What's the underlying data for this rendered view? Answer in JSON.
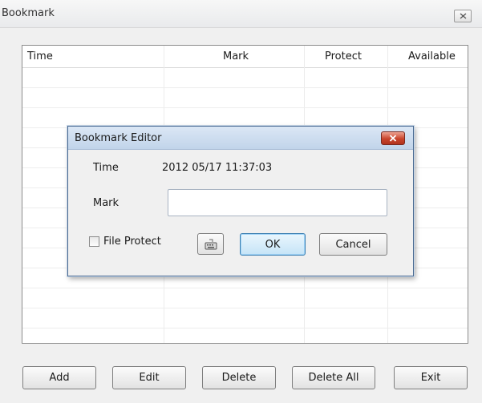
{
  "window": {
    "title": "Bookmark",
    "close_icon": "close-x-icon"
  },
  "list": {
    "columns": [
      "Time",
      "Mark",
      "Protect",
      "Available"
    ]
  },
  "buttons": {
    "add": "Add",
    "edit": "Edit",
    "delete": "Delete",
    "delete_all": "Delete All",
    "exit": "Exit"
  },
  "dialog": {
    "title": "Bookmark Editor",
    "time_label": "Time",
    "time_value": "2012 05/17 11:37:03",
    "mark_label": "Mark",
    "mark_value": "",
    "file_protect_label": "File Protect",
    "file_protect_checked": false,
    "keyboard_icon": "keyboard-icon",
    "ok_label": "OK",
    "cancel_label": "Cancel",
    "close_color": "#c9442c"
  }
}
